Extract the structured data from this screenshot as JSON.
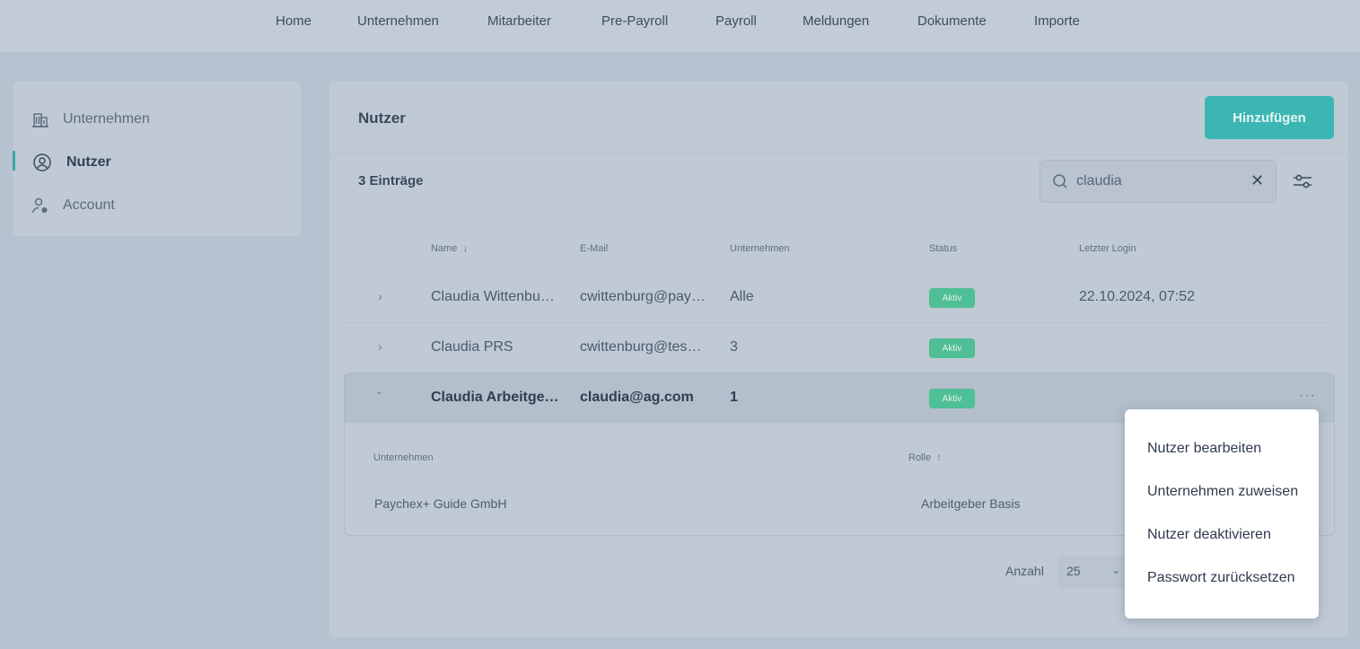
{
  "nav": {
    "items": [
      "Home",
      "Unternehmen",
      "Mitarbeiter",
      "Pre-Payroll",
      "Payroll",
      "Meldungen",
      "Dokumente",
      "Importe"
    ]
  },
  "sidebar": {
    "items": [
      {
        "label": "Unternehmen",
        "icon": "building-icon"
      },
      {
        "label": "Nutzer",
        "icon": "user-circle-icon",
        "active": true
      },
      {
        "label": "Account",
        "icon": "user-settings-icon"
      }
    ]
  },
  "main": {
    "title": "Nutzer",
    "add_label": "Hinzufügen",
    "entries": "3 Einträge",
    "search": {
      "value": "claudia"
    },
    "columns": {
      "name": "Name",
      "email": "E-Mail",
      "company": "Unternehmen",
      "status": "Status",
      "login": "Letzter Login"
    },
    "rows": [
      {
        "name": "Claudia Wittenbu…",
        "email": "cwittenburg@pay…",
        "company": "Alle",
        "status": "Aktiv",
        "login": "22.10.2024, 07:52"
      },
      {
        "name": "Claudia PRS",
        "email": "cwittenburg@tes…",
        "company": "3",
        "status": "Aktiv",
        "login": ""
      },
      {
        "name": "Claudia Arbeitge…",
        "email": "claudia@ag.com",
        "company": "1",
        "status": "Aktiv",
        "login": ""
      }
    ],
    "detail": {
      "col_company": "Unternehmen",
      "col_role": "Rolle",
      "company": "Paychex+ Guide GmbH",
      "role": "Arbeitgeber Basis"
    },
    "pager": {
      "label": "Anzahl",
      "value": "25"
    }
  },
  "menu": {
    "items": [
      "Nutzer bearbeiten",
      "Unternehmen zuweisen",
      "Nutzer deaktivieren",
      "Passwort zurücksetzen"
    ]
  },
  "colors": {
    "accent": "#3bb6b3",
    "active_badge": "#4fbf96",
    "overlay_bg": "#b6c2cf"
  }
}
